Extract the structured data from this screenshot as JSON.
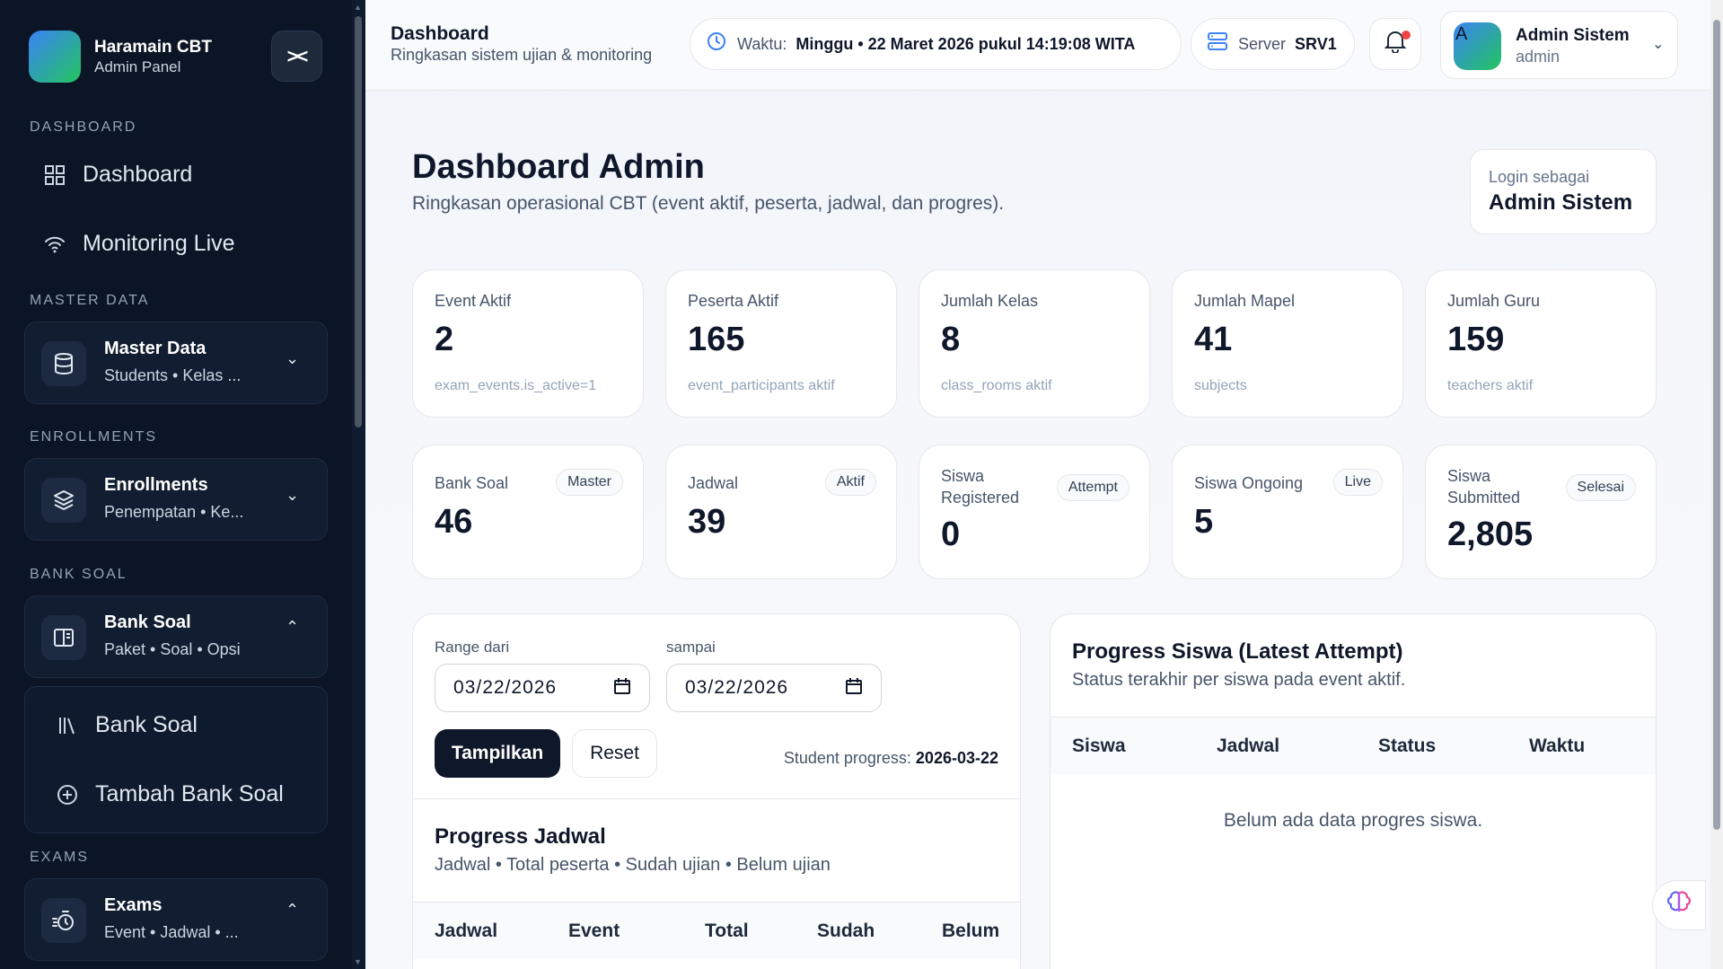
{
  "brand": {
    "title": "Haramain CBT",
    "subtitle": "Admin Panel"
  },
  "sidebar": {
    "sections": {
      "dashboard": "DASHBOARD",
      "master": "MASTER DATA",
      "enrollments": "ENROLLMENTS",
      "bank": "BANK SOAL",
      "exams": "EXAMS"
    },
    "items": {
      "dashboard": "Dashboard",
      "monitoring": "Monitoring Live"
    },
    "groups": {
      "master": {
        "title": "Master Data",
        "subtitle": "Students • Kelas ..."
      },
      "enrollments": {
        "title": "Enrollments",
        "subtitle": "Penempatan • Ke..."
      },
      "bank": {
        "title": "Bank Soal",
        "subtitle": "Paket • Soal • Opsi"
      },
      "exams": {
        "title": "Exams",
        "subtitle": "Event • Jadwal • ..."
      }
    },
    "sub_items": {
      "bank_soal": "Bank Soal",
      "tambah": "Tambah Bank Soal"
    }
  },
  "topbar": {
    "title": "Dashboard",
    "subtitle": "Ringkasan sistem ujian & monitoring",
    "time_label": "Waktu:",
    "time_value": "Minggu • 22 Maret 2026 pukul 14:19:08 WITA",
    "server_label": "Server",
    "server_value": "SRV1",
    "user_name": "Admin Sistem",
    "user_role": "admin",
    "avatar_letter": "A"
  },
  "page": {
    "title": "Dashboard Admin",
    "subtitle": "Ringkasan operasional CBT (event aktif, peserta, jadwal, dan progres).",
    "login_label": "Login sebagai",
    "login_name": "Admin Sistem"
  },
  "stats_row1": [
    {
      "label": "Event Aktif",
      "value": "2",
      "sub": "exam_events.is_active=1"
    },
    {
      "label": "Peserta Aktif",
      "value": "165",
      "sub": "event_participants aktif"
    },
    {
      "label": "Jumlah Kelas",
      "value": "8",
      "sub": "class_rooms aktif"
    },
    {
      "label": "Jumlah Mapel",
      "value": "41",
      "sub": "subjects"
    },
    {
      "label": "Jumlah Guru",
      "value": "159",
      "sub": "teachers aktif"
    }
  ],
  "stats_row2": [
    {
      "label": "Bank Soal",
      "value": "46",
      "badge": "Master"
    },
    {
      "label": "Jadwal",
      "value": "39",
      "badge": "Aktif"
    },
    {
      "label": "Siswa Registered",
      "value": "0",
      "badge": "Attempt"
    },
    {
      "label": "Siswa Ongoing",
      "value": "5",
      "badge": "Live"
    },
    {
      "label": "Siswa Submitted",
      "value": "2,805",
      "badge": "Selesai"
    }
  ],
  "filter": {
    "from_label": "Range dari",
    "from_value": "03/22/2026",
    "to_label": "sampai",
    "to_value": "03/22/2026",
    "show_button": "Tampilkan",
    "reset_button": "Reset",
    "progress_label": "Student progress:",
    "progress_date": "2026-03-22"
  },
  "progress_jadwal": {
    "title": "Progress Jadwal",
    "subtitle": "Jadwal • Total peserta • Sudah ujian • Belum ujian",
    "columns": [
      "Jadwal",
      "Event",
      "Total",
      "Sudah",
      "Belum"
    ]
  },
  "progress_siswa": {
    "title": "Progress Siswa (Latest Attempt)",
    "subtitle": "Status terakhir per siswa pada event aktif.",
    "columns": [
      "Siswa",
      "Jadwal",
      "Status",
      "Waktu"
    ],
    "empty": "Belum ada data progres siswa."
  }
}
